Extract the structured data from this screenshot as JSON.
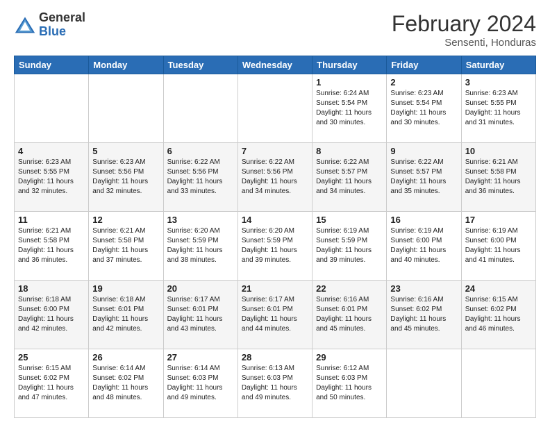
{
  "header": {
    "logo_general": "General",
    "logo_blue": "Blue",
    "month_year": "February 2024",
    "location": "Sensenti, Honduras"
  },
  "weekdays": [
    "Sunday",
    "Monday",
    "Tuesday",
    "Wednesday",
    "Thursday",
    "Friday",
    "Saturday"
  ],
  "weeks": [
    [
      {
        "day": "",
        "info": ""
      },
      {
        "day": "",
        "info": ""
      },
      {
        "day": "",
        "info": ""
      },
      {
        "day": "",
        "info": ""
      },
      {
        "day": "1",
        "info": "Sunrise: 6:24 AM\nSunset: 5:54 PM\nDaylight: 11 hours and 30 minutes."
      },
      {
        "day": "2",
        "info": "Sunrise: 6:23 AM\nSunset: 5:54 PM\nDaylight: 11 hours and 30 minutes."
      },
      {
        "day": "3",
        "info": "Sunrise: 6:23 AM\nSunset: 5:55 PM\nDaylight: 11 hours and 31 minutes."
      }
    ],
    [
      {
        "day": "4",
        "info": "Sunrise: 6:23 AM\nSunset: 5:55 PM\nDaylight: 11 hours and 32 minutes."
      },
      {
        "day": "5",
        "info": "Sunrise: 6:23 AM\nSunset: 5:56 PM\nDaylight: 11 hours and 32 minutes."
      },
      {
        "day": "6",
        "info": "Sunrise: 6:22 AM\nSunset: 5:56 PM\nDaylight: 11 hours and 33 minutes."
      },
      {
        "day": "7",
        "info": "Sunrise: 6:22 AM\nSunset: 5:56 PM\nDaylight: 11 hours and 34 minutes."
      },
      {
        "day": "8",
        "info": "Sunrise: 6:22 AM\nSunset: 5:57 PM\nDaylight: 11 hours and 34 minutes."
      },
      {
        "day": "9",
        "info": "Sunrise: 6:22 AM\nSunset: 5:57 PM\nDaylight: 11 hours and 35 minutes."
      },
      {
        "day": "10",
        "info": "Sunrise: 6:21 AM\nSunset: 5:58 PM\nDaylight: 11 hours and 36 minutes."
      }
    ],
    [
      {
        "day": "11",
        "info": "Sunrise: 6:21 AM\nSunset: 5:58 PM\nDaylight: 11 hours and 36 minutes."
      },
      {
        "day": "12",
        "info": "Sunrise: 6:21 AM\nSunset: 5:58 PM\nDaylight: 11 hours and 37 minutes."
      },
      {
        "day": "13",
        "info": "Sunrise: 6:20 AM\nSunset: 5:59 PM\nDaylight: 11 hours and 38 minutes."
      },
      {
        "day": "14",
        "info": "Sunrise: 6:20 AM\nSunset: 5:59 PM\nDaylight: 11 hours and 39 minutes."
      },
      {
        "day": "15",
        "info": "Sunrise: 6:19 AM\nSunset: 5:59 PM\nDaylight: 11 hours and 39 minutes."
      },
      {
        "day": "16",
        "info": "Sunrise: 6:19 AM\nSunset: 6:00 PM\nDaylight: 11 hours and 40 minutes."
      },
      {
        "day": "17",
        "info": "Sunrise: 6:19 AM\nSunset: 6:00 PM\nDaylight: 11 hours and 41 minutes."
      }
    ],
    [
      {
        "day": "18",
        "info": "Sunrise: 6:18 AM\nSunset: 6:00 PM\nDaylight: 11 hours and 42 minutes."
      },
      {
        "day": "19",
        "info": "Sunrise: 6:18 AM\nSunset: 6:01 PM\nDaylight: 11 hours and 42 minutes."
      },
      {
        "day": "20",
        "info": "Sunrise: 6:17 AM\nSunset: 6:01 PM\nDaylight: 11 hours and 43 minutes."
      },
      {
        "day": "21",
        "info": "Sunrise: 6:17 AM\nSunset: 6:01 PM\nDaylight: 11 hours and 44 minutes."
      },
      {
        "day": "22",
        "info": "Sunrise: 6:16 AM\nSunset: 6:01 PM\nDaylight: 11 hours and 45 minutes."
      },
      {
        "day": "23",
        "info": "Sunrise: 6:16 AM\nSunset: 6:02 PM\nDaylight: 11 hours and 45 minutes."
      },
      {
        "day": "24",
        "info": "Sunrise: 6:15 AM\nSunset: 6:02 PM\nDaylight: 11 hours and 46 minutes."
      }
    ],
    [
      {
        "day": "25",
        "info": "Sunrise: 6:15 AM\nSunset: 6:02 PM\nDaylight: 11 hours and 47 minutes."
      },
      {
        "day": "26",
        "info": "Sunrise: 6:14 AM\nSunset: 6:02 PM\nDaylight: 11 hours and 48 minutes."
      },
      {
        "day": "27",
        "info": "Sunrise: 6:14 AM\nSunset: 6:03 PM\nDaylight: 11 hours and 49 minutes."
      },
      {
        "day": "28",
        "info": "Sunrise: 6:13 AM\nSunset: 6:03 PM\nDaylight: 11 hours and 49 minutes."
      },
      {
        "day": "29",
        "info": "Sunrise: 6:12 AM\nSunset: 6:03 PM\nDaylight: 11 hours and 50 minutes."
      },
      {
        "day": "",
        "info": ""
      },
      {
        "day": "",
        "info": ""
      }
    ]
  ]
}
